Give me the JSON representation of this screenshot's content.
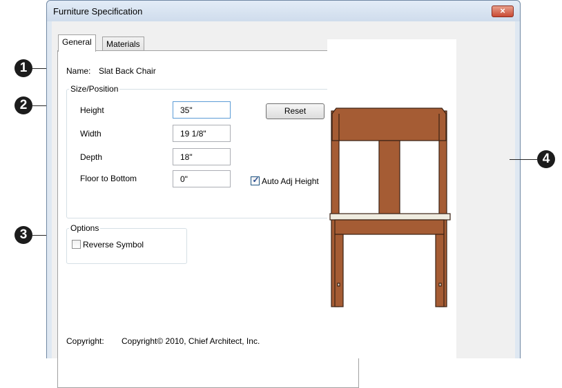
{
  "dialog": {
    "title": "Furniture Specification",
    "close_symbol": "×",
    "tabs": [
      {
        "label": "General",
        "active": true
      },
      {
        "label": "Materials",
        "active": false
      }
    ]
  },
  "general": {
    "name_label": "Name:",
    "name_value": "Slat Back Chair",
    "size_position": {
      "group_label": "Size/Position",
      "height_label": "Height",
      "height_value": "35\"",
      "width_label": "Width",
      "width_value": "19 1/8\"",
      "depth_label": "Depth",
      "depth_value": "18\"",
      "floor_label": "Floor to Bottom",
      "floor_value": "0\"",
      "reset_label": "Reset",
      "auto_adj_label": "Auto Adj Height",
      "auto_adj_checked": true
    },
    "options": {
      "group_label": "Options",
      "reverse_label": "Reverse Symbol",
      "reverse_checked": false
    },
    "copyright_label": "Copyright:",
    "copyright_value": "Copyright© 2010, Chief Architect, Inc."
  },
  "callouts": [
    "1",
    "2",
    "3",
    "4"
  ],
  "preview": {
    "icon": "chair-preview-icon",
    "colors": {
      "wood": "#a55c34",
      "outline": "#3a2214",
      "seat": "#efece0"
    }
  },
  "colors": {
    "window_frame": "#dfe8f2",
    "close_button": "#c94a34",
    "client": "#f0f0f0"
  }
}
